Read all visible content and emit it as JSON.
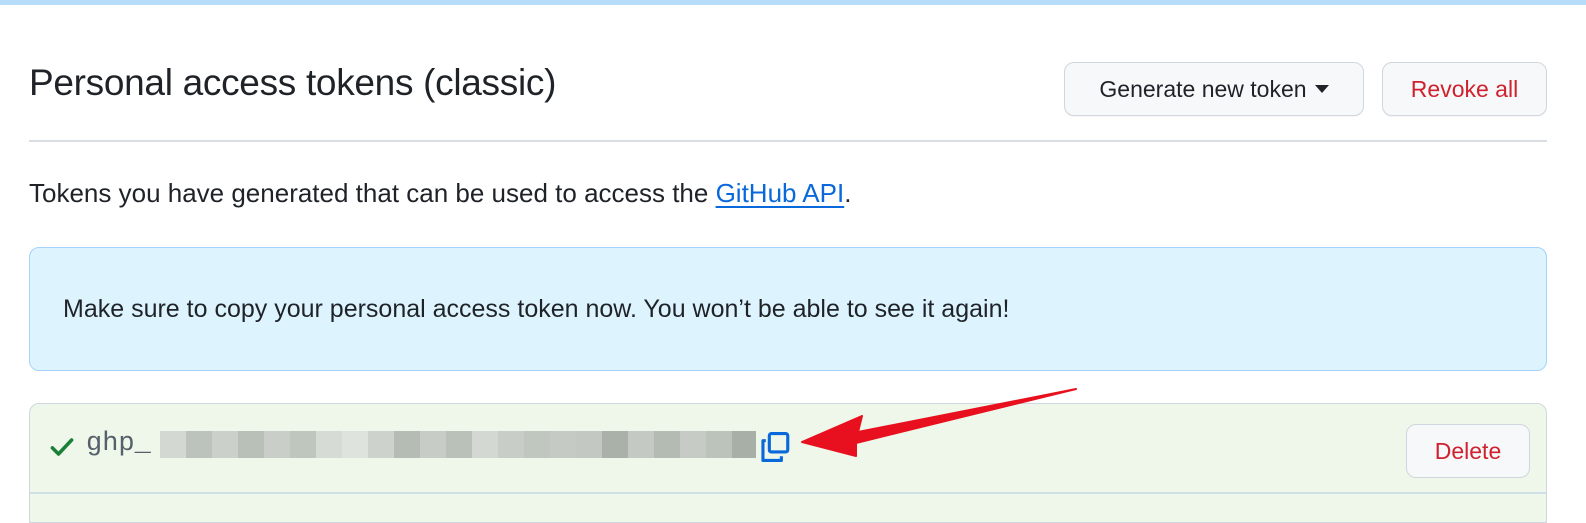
{
  "header": {
    "title": "Personal access tokens (classic)",
    "generate_label": "Generate new token",
    "revoke_label": "Revoke all"
  },
  "description": {
    "text_before": "Tokens you have generated that can be used to access the ",
    "link_text": "GitHub API",
    "text_after": "."
  },
  "flash": {
    "message": "Make sure to copy your personal access token now. You won’t be able to see it again!"
  },
  "token": {
    "prefix": "ghp_",
    "value_hidden": true,
    "delete_label": "Delete"
  },
  "icons": {
    "check": "check-icon",
    "copy": "copy-icon",
    "caret": "caret-down-icon",
    "annotation": "red-arrow"
  },
  "colors": {
    "accent_link": "#0969da",
    "danger": "#cf222e",
    "success": "#1a7f37",
    "flash_bg": "#ddf4ff",
    "token_bg": "#eef7ea",
    "annotation_red": "#e8101e"
  }
}
